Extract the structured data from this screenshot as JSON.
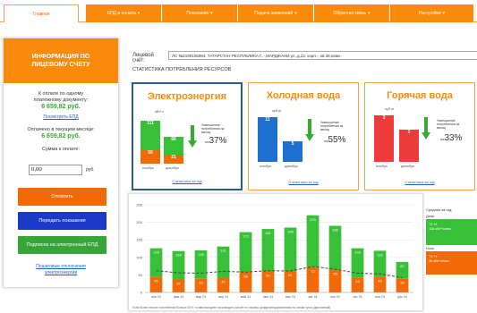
{
  "nav": {
    "tabs": [
      {
        "label": "Главная",
        "caret": ""
      },
      {
        "label": "ЕПД и оплата",
        "caret": "▾"
      },
      {
        "label": "Показания",
        "caret": "▾"
      },
      {
        "label": "Подача заявлений",
        "caret": "▾"
      },
      {
        "label": "Обратная связь",
        "caret": "▾"
      },
      {
        "label": "Настройки",
        "caret": "▾"
      }
    ]
  },
  "left": {
    "title_line1": "ИНФОРМАЦИЯ ПО",
    "title_line2": "ЛИЦЕВОМУ СЧЕТУ",
    "to_pay_line1": "К оплате по одному",
    "to_pay_line2": "платежному документу:",
    "to_pay_sum": "6 659,82 руб.",
    "view_epd": "Посмотреть ЕПД",
    "paid_label": "Оплачено в текущем месяце:",
    "paid_sum": "6 659,82 руб.",
    "amount_label": "Сумма к оплате:",
    "amount_value": "0,00",
    "amount_unit": "руб.",
    "btn_pay": "Оплатить",
    "btn_readings": "Передать показания",
    "btn_epd": "Подписка на электронный ЕПД",
    "footer_link_line1": "Пошаговые отключения",
    "footer_link_line2": "электроэнергии"
  },
  "account": {
    "label": "Лицевой счёт:",
    "value": "ЛС №2190105084, ТАТАРСТАН РЕСПУБЛИКА Г.,-,МАРДЖАНИ ул.,д.22, корп.-, кв.48,комн.-"
  },
  "stats_title": "СТАТИСТИКА ПОТРЕБЛЕНИЯ РЕСУРСОВ",
  "cards": [
    {
      "title": "Электроэнергия",
      "unit": "кВт*ч",
      "bar1_top": "111",
      "bar1_bottom": "50",
      "bar2_top": "66",
      "bar2_bottom": "21",
      "month1": "ноябрь",
      "month2": "декабрь",
      "decrease_text": "Уменьшение потребления за месяц",
      "pct_prefix": "на",
      "pct": "37%",
      "link": "Статистика за год"
    },
    {
      "title": "Холодная вода",
      "unit": "куб.м",
      "bar1_top": "11",
      "bar2_top": "5",
      "month1": "ноябрь",
      "month2": "декабрь",
      "decrease_text": "Уменьшение потребления за месяц",
      "pct_prefix": "на",
      "pct": "55%",
      "link": "Статистика за год"
    },
    {
      "title": "Горячая вода",
      "unit": "куб.м",
      "bar1_top": "3",
      "bar2_top": "2",
      "month1": "ноябрь",
      "month2": "декабрь",
      "decrease_text": "Уменьшение потребления за месяц",
      "pct_prefix": "на",
      "pct": "33%",
      "link": "Статистика за год"
    }
  ],
  "legend": {
    "title": "Средняя за год:",
    "day_label": "День",
    "day_line1": "Т1 %",
    "day_line2": "118 кВт*ч/мес",
    "night_label": "Ночь",
    "night_line1": "Т2 %",
    "night_line2": "36 кВт*ч/мес"
  },
  "chart_data": {
    "type": "bar",
    "title": "",
    "ylim": [
      0,
      250
    ],
    "yticks": [
      0,
      50,
      100,
      150,
      200,
      250
    ],
    "categories": [
      "янв 24",
      "фев 24",
      "мар 24",
      "апр 24",
      "май 24",
      "июн 24",
      "июл 24",
      "авг 24",
      "сен 24",
      "окт 24",
      "ноя 24",
      "дек 24"
    ],
    "series": [
      {
        "name": "День",
        "color": "#39c039",
        "values": [
          81,
          81,
          81,
          89,
          114,
          121,
          124,
          148,
          125,
          83,
          74,
          48
        ],
        "labels": [
          "126",
          "118",
          "120",
          "131",
          "172",
          "181",
          "185",
          "220",
          "190",
          "126",
          "119",
          "87"
        ]
      },
      {
        "name": "Ночь",
        "color": "#f26a06",
        "values": [
          45,
          37,
          39,
          42,
          58,
          60,
          61,
          72,
          65,
          43,
          45,
          39
        ],
        "labels": [
          "45",
          "37",
          "39",
          "42",
          "58",
          "60",
          "61",
          "72",
          "65",
          "43",
          "45",
          "39"
        ]
      }
    ],
    "average_line": [
      62,
      56,
      55,
      60,
      58,
      62,
      61,
      74,
      66,
      55,
      53,
      42
    ],
    "footnote": "Если более ночное потребление больше 30%, то вам выгоднее производить расчёт по тарифу, дифференцированному по зонам суток (двухзонный)."
  }
}
